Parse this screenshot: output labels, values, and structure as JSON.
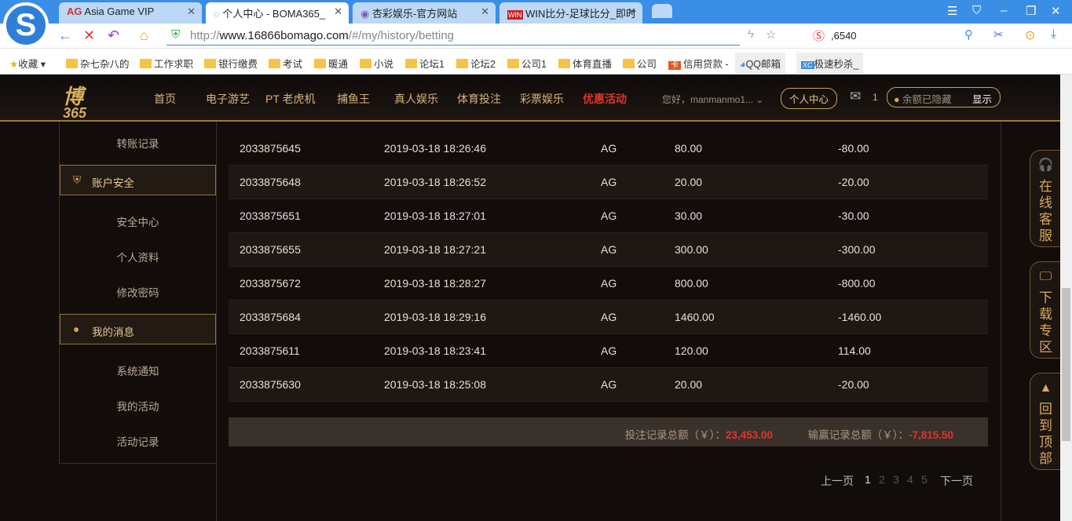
{
  "browser": {
    "tabs": [
      {
        "label": "Asia Game VIP"
      },
      {
        "label": "个人中心 - BOMA365_"
      },
      {
        "label": "杏彩娱乐-官方网站"
      },
      {
        "label": "WIN比分-足球比分_即时"
      }
    ],
    "url_prefix": "http://",
    "url_domain": "www.16866bomago.com",
    "url_path": "/#/my/history/betting",
    "search_value": ",6540",
    "bookmarks": [
      "收藏",
      "杂七杂八的",
      "工作求职",
      "银行缴费",
      "考试",
      "暖通",
      "小说",
      "论坛1",
      "论坛2",
      "公司1",
      "体育直播",
      "公司",
      "信用贷款 -",
      "QQ邮箱",
      "极速秒杀_"
    ]
  },
  "site": {
    "nav": [
      "首页",
      "电子游艺",
      "PT 老虎机",
      "捕鱼王",
      "真人娱乐",
      "体育投注",
      "彩票娱乐",
      "优惠活动"
    ],
    "greeting": "您好，manmanmo1...",
    "personal_center": "个人中心",
    "mail_count": "1",
    "balance_hidden": "余额已隐藏",
    "show": "显示"
  },
  "sidebar": {
    "transfer": "转账记录",
    "security_head": "账户安全",
    "security_items": [
      "安全中心",
      "个人资料",
      "修改密码"
    ],
    "messages_head": "我的消息",
    "message_items": [
      "系统通知",
      "我的活动",
      "活动记录"
    ]
  },
  "rows": [
    {
      "id": "2033875645",
      "time": "2019-03-18 18:26:46",
      "platform": "AG",
      "bet": "80.00",
      "result": "-80.00"
    },
    {
      "id": "2033875648",
      "time": "2019-03-18 18:26:52",
      "platform": "AG",
      "bet": "20.00",
      "result": "-20.00"
    },
    {
      "id": "2033875651",
      "time": "2019-03-18 18:27:01",
      "platform": "AG",
      "bet": "30.00",
      "result": "-30.00"
    },
    {
      "id": "2033875655",
      "time": "2019-03-18 18:27:21",
      "platform": "AG",
      "bet": "300.00",
      "result": "-300.00"
    },
    {
      "id": "2033875672",
      "time": "2019-03-18 18:28:27",
      "platform": "AG",
      "bet": "800.00",
      "result": "-800.00"
    },
    {
      "id": "2033875684",
      "time": "2019-03-18 18:29:16",
      "platform": "AG",
      "bet": "1460.00",
      "result": "-1460.00"
    },
    {
      "id": "2033875611",
      "time": "2019-03-18 18:23:41",
      "platform": "AG",
      "bet": "120.00",
      "result": "114.00"
    },
    {
      "id": "2033875630",
      "time": "2019-03-18 18:25:08",
      "platform": "AG",
      "bet": "20.00",
      "result": "-20.00"
    }
  ],
  "summary": {
    "bet_label": "投注记录总额（￥）：",
    "bet_total": "23,453.00",
    "win_label": "输赢记录总额（￥）：",
    "win_total": "-7,815.50"
  },
  "pagination": {
    "prev": "上一页",
    "pages": [
      "1",
      "2",
      "3",
      "4",
      "5"
    ],
    "next": "下一页"
  },
  "float": {
    "service": "在线客服",
    "download": "下载专区",
    "top": "回到顶部"
  }
}
